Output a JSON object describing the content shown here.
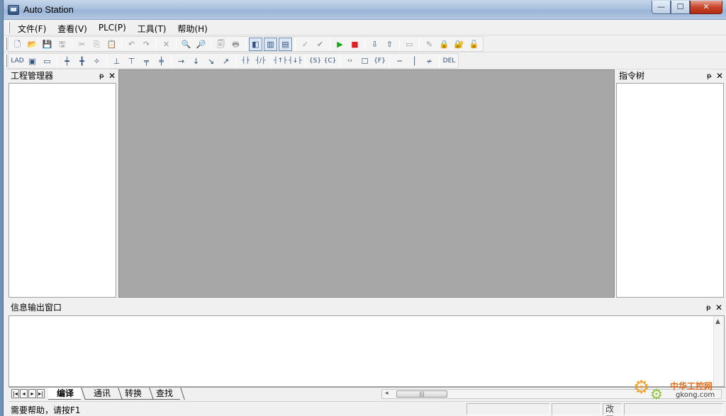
{
  "window": {
    "title": "Auto Station",
    "controls": {
      "minimize": "—",
      "maximize": "☐",
      "close": "✕"
    }
  },
  "menu": {
    "items": [
      "文件(F)",
      "查看(V)",
      "PLC(P)",
      "工具(T)",
      "帮助(H)"
    ]
  },
  "toolbar1": {
    "buttons": [
      {
        "glyph": "🗋",
        "icon": "new-file-icon"
      },
      {
        "glyph": "📂",
        "icon": "open-folder-icon"
      },
      {
        "glyph": "💾",
        "icon": "save-icon"
      },
      {
        "glyph": "🖫",
        "icon": "save-all-icon"
      },
      {
        "glyph": "✂",
        "icon": "cut-icon"
      },
      {
        "glyph": "⎘",
        "icon": "copy-icon"
      },
      {
        "glyph": "📋",
        "icon": "paste-icon"
      },
      {
        "glyph": "↶",
        "icon": "undo-icon"
      },
      {
        "glyph": "↷",
        "icon": "redo-icon"
      },
      {
        "glyph": "✕",
        "icon": "delete-icon"
      },
      {
        "glyph": "🔍",
        "icon": "find-icon"
      },
      {
        "glyph": "🔎",
        "icon": "replace-icon"
      },
      {
        "glyph": "🗐",
        "icon": "print-preview-icon"
      },
      {
        "glyph": "🖶",
        "icon": "print-icon"
      },
      {
        "glyph": "◧",
        "icon": "project-pane-icon"
      },
      {
        "glyph": "▥",
        "icon": "instruction-pane-icon"
      },
      {
        "glyph": "▤",
        "icon": "output-pane-icon"
      },
      {
        "glyph": "✓",
        "icon": "check-icon"
      },
      {
        "glyph": "✔",
        "icon": "compile-icon"
      },
      {
        "glyph": "▶",
        "icon": "run-icon"
      },
      {
        "glyph": "■",
        "icon": "stop-icon"
      },
      {
        "glyph": "⇩",
        "icon": "download-icon"
      },
      {
        "glyph": "⇧",
        "icon": "upload-icon"
      },
      {
        "glyph": "▭",
        "icon": "monitor-icon"
      },
      {
        "glyph": "✎",
        "icon": "edit-icon"
      },
      {
        "glyph": "🔒",
        "icon": "lock-icon"
      },
      {
        "glyph": "🔐",
        "icon": "password-icon"
      },
      {
        "glyph": "🔓",
        "icon": "unlock-icon"
      }
    ]
  },
  "toolbar2": {
    "buttons": [
      {
        "glyph": "LAD",
        "icon": "ladder-mode-icon"
      },
      {
        "glyph": "▣",
        "icon": "block-icon"
      },
      {
        "glyph": "▭",
        "icon": "box-icon"
      },
      {
        "glyph": "┿",
        "icon": "insert-row-icon"
      },
      {
        "glyph": "╋",
        "icon": "insert-column-icon"
      },
      {
        "glyph": "✧",
        "icon": "branch-icon"
      },
      {
        "glyph": "⊥",
        "icon": "parallel-branch-icon"
      },
      {
        "glyph": "⊤",
        "icon": "parallel-end-icon"
      },
      {
        "glyph": "╤",
        "icon": "branch-down-icon"
      },
      {
        "glyph": "╪",
        "icon": "branch-cross-icon"
      },
      {
        "glyph": "→",
        "icon": "arrow-right-icon"
      },
      {
        "glyph": "↓",
        "icon": "arrow-down-icon"
      },
      {
        "glyph": "↘",
        "icon": "arrow-down-right-icon"
      },
      {
        "glyph": "↗",
        "icon": "arrow-up-right-icon"
      },
      {
        "glyph": "┤├",
        "icon": "contact-no-icon"
      },
      {
        "glyph": "┤/├",
        "icon": "contact-nc-icon"
      },
      {
        "glyph": "┤↑├",
        "icon": "contact-rising-icon"
      },
      {
        "glyph": "┤↓├",
        "icon": "contact-falling-icon"
      },
      {
        "glyph": "{S}",
        "icon": "set-coil-icon"
      },
      {
        "glyph": "{C}",
        "icon": "reset-coil-icon"
      },
      {
        "glyph": "‹›",
        "icon": "coil-icon"
      },
      {
        "glyph": "☐",
        "icon": "function-block-icon"
      },
      {
        "glyph": "{F}",
        "icon": "function-icon"
      },
      {
        "glyph": "─",
        "icon": "horizontal-line-icon"
      },
      {
        "glyph": "│",
        "icon": "vertical-line-icon"
      },
      {
        "glyph": "≁",
        "icon": "invert-icon"
      },
      {
        "glyph": "DEL",
        "icon": "delete-line-icon"
      }
    ]
  },
  "project_panel": {
    "title": "工程管理器",
    "pin": "ᵽ",
    "close": "✕"
  },
  "instruction_panel": {
    "title": "指令树",
    "pin": "ᵽ",
    "close": "✕"
  },
  "output_panel": {
    "title": "信息输出窗口",
    "pin": "ᵽ",
    "close": "✕"
  },
  "output_tabs": {
    "nav": [
      "|◂",
      "◂",
      "▸",
      "▸|"
    ],
    "tabs": [
      "编译",
      "通讯",
      "转换",
      "查找"
    ],
    "active": 0,
    "hscroll_thumb": "|||"
  },
  "status": {
    "help_text": "需要帮助，请按F1",
    "panes": [
      "",
      "",
      "改写",
      ""
    ]
  },
  "watermark": {
    "cn": "中华工控网",
    "en": "gkong.com"
  },
  "colors": {
    "workspace": "#a7a7a7",
    "run": "#1aa31a",
    "stop": "#e02020"
  }
}
